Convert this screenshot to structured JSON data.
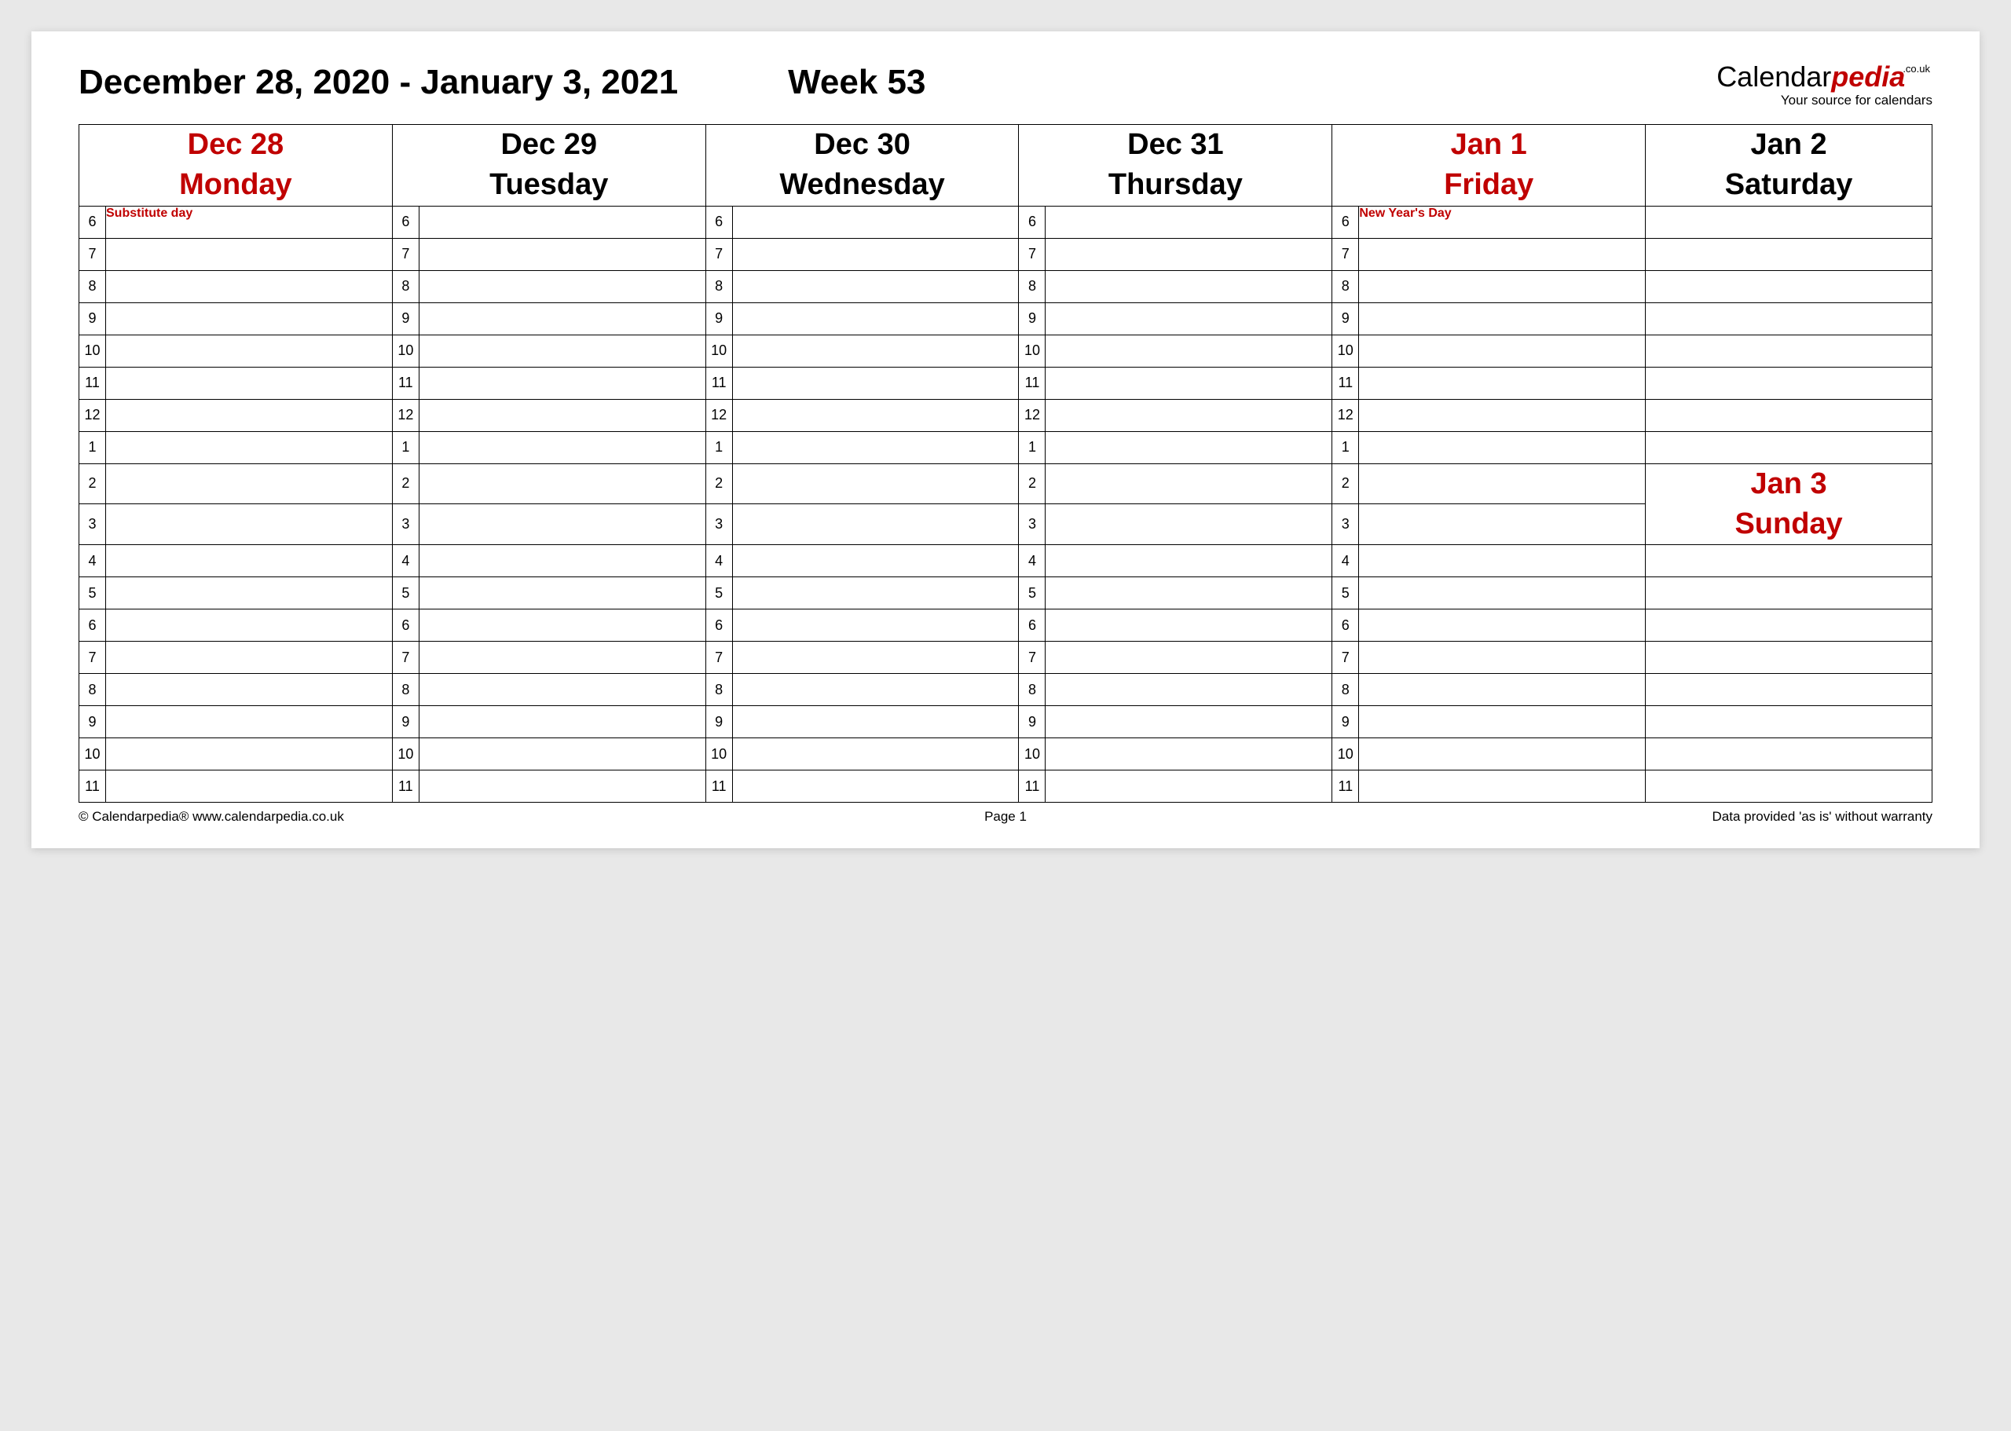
{
  "header": {
    "date_range": "December 28, 2020 - January 3, 2021",
    "week_label": "Week 53",
    "brand_part1": "Calendar",
    "brand_part2": "pedia",
    "brand_domain": ".co.uk",
    "tagline": "Your source for calendars"
  },
  "hours": [
    "6",
    "7",
    "8",
    "9",
    "10",
    "11",
    "12",
    "1",
    "2",
    "3",
    "4",
    "5",
    "6",
    "7",
    "8",
    "9",
    "10",
    "11"
  ],
  "days": [
    {
      "date": "Dec 28",
      "weekday": "Monday",
      "highlight": true,
      "note": "Substitute day"
    },
    {
      "date": "Dec 29",
      "weekday": "Tuesday",
      "highlight": false,
      "note": ""
    },
    {
      "date": "Dec 30",
      "weekday": "Wednesday",
      "highlight": false,
      "note": ""
    },
    {
      "date": "Dec 31",
      "weekday": "Thursday",
      "highlight": false,
      "note": ""
    },
    {
      "date": "Jan 1",
      "weekday": "Friday",
      "highlight": true,
      "note": "New Year's Day"
    }
  ],
  "weekend": {
    "sat_date": "Jan 2",
    "sat_weekday": "Saturday",
    "sun_date": "Jan 3",
    "sun_weekday": "Sunday"
  },
  "footer": {
    "left": "© Calendarpedia®   www.calendarpedia.co.uk",
    "center": "Page 1",
    "right": "Data provided 'as is' without warranty"
  }
}
